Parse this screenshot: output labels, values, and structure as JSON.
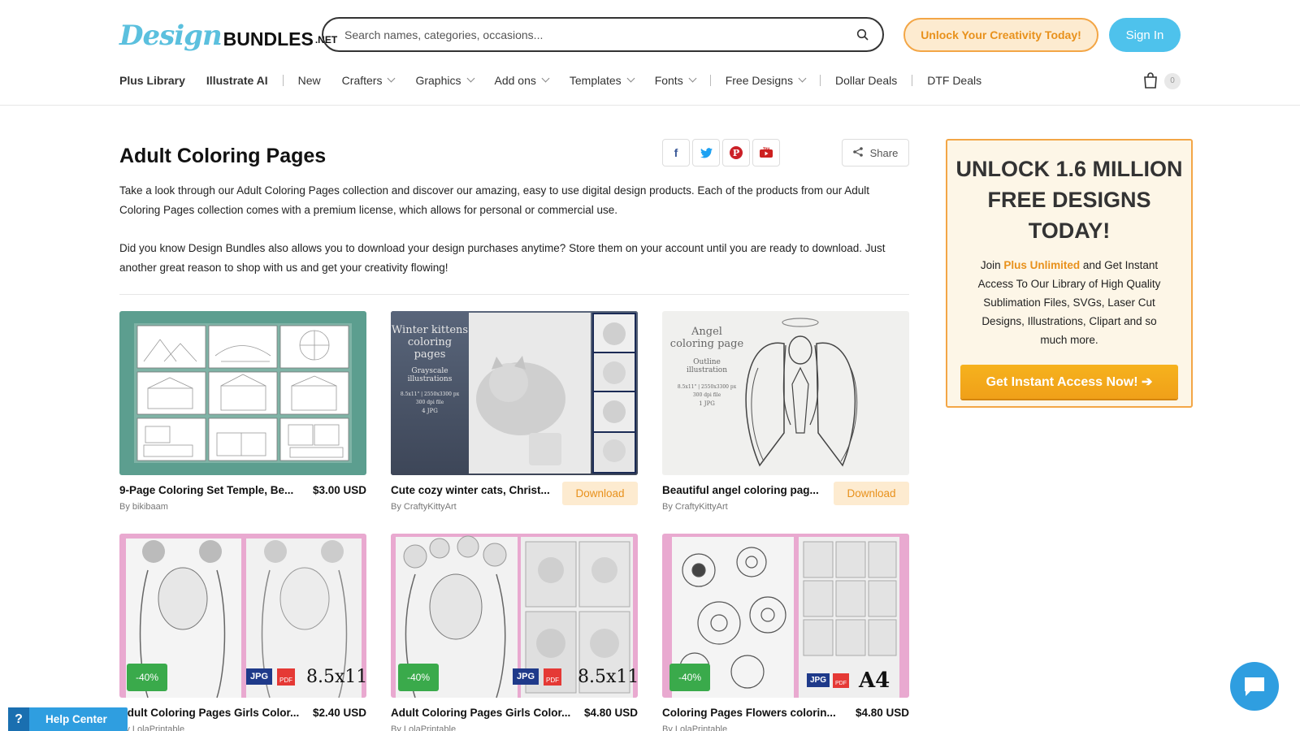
{
  "header": {
    "logo": {
      "script": "Design",
      "word": "BUNDLES",
      "tld": ".NET"
    },
    "search_placeholder": "Search names, categories, occasions...",
    "unlock_label": "Unlock Your Creativity Today!",
    "signin_label": "Sign In",
    "cart_count": "0",
    "nav": [
      {
        "label": "Plus Library"
      },
      {
        "label": "Illustrate AI"
      },
      {
        "label": "New"
      },
      {
        "label": "Crafters"
      },
      {
        "label": "Graphics"
      },
      {
        "label": "Add ons"
      },
      {
        "label": "Templates"
      },
      {
        "label": "Fonts"
      },
      {
        "label": "Free Designs"
      },
      {
        "label": "Dollar Deals"
      },
      {
        "label": "DTF Deals"
      }
    ]
  },
  "main": {
    "title": "Adult Coloring Pages",
    "share_label": "Share",
    "social": [
      "facebook-icon",
      "twitter-icon",
      "pinterest-icon",
      "youtube-icon"
    ],
    "description_1": "Take a look through our Adult Coloring Pages collection and discover our amazing, easy to use digital design products. Each of the products from our Adult Coloring Pages collection comes with a premium license, which allows for personal or commercial use.",
    "description_2": "Did you know Design Bundles also allows you to download your design purchases anytime? Store them on your account until you are ready to download. Just another great reason to shop with us and get your creativity flowing!"
  },
  "products": [
    {
      "title": "9-Page Coloring Set Temple, Be...",
      "author": "By bikibaam",
      "price": "$3.00 USD"
    },
    {
      "title": "Cute cozy winter cats, Christ...",
      "author": "By CraftyKittyArt",
      "download": "Download",
      "thumb_lines": [
        "Winter kittens",
        "coloring pages",
        "Grayscale",
        "illustrations",
        "8.5x11\" | 2550x3300 px",
        "300 dpi file",
        "4 JPG"
      ]
    },
    {
      "title": "Beautiful angel coloring pag...",
      "author": "By CraftyKittyArt",
      "download": "Download",
      "thumb_lines": [
        "Angel",
        "coloring page",
        "Outline",
        "illustration",
        "8.5x11\" | 2550x3300 px",
        "300 dpi file",
        "1 JPG"
      ]
    },
    {
      "title": "Adult Coloring Pages Girls Color...",
      "author": "By LolaPrintable",
      "price": "$2.40 USD",
      "badge": "-40%",
      "size": "8.5x11\"",
      "file": "JPG"
    },
    {
      "title": "Adult Coloring Pages Girls Color...",
      "author": "By LolaPrintable",
      "price": "$4.80 USD",
      "badge": "-40%",
      "size": "8.5x11\"",
      "file": "JPG"
    },
    {
      "title": "Coloring Pages Flowers colorin...",
      "author": "By LolaPrintable",
      "price": "$4.80 USD",
      "badge": "-40%",
      "size": "A4",
      "file": "JPG"
    }
  ],
  "promo": {
    "title": "UNLOCK 1.6 MILLION FREE DESIGNS TODAY!",
    "text_before": "Join ",
    "highlight": "Plus Unlimited",
    "text_after": " and Get Instant Access To Our Library of High Quality Sublimation Files, SVGs, Laser Cut Designs, Illustrations, Clipart and so much more.",
    "cta": "Get Instant Access Now! ➔"
  },
  "help_label": "Help Center",
  "colors": {
    "accent": "#4ec2ec",
    "orange": "#f3a646",
    "green_badge": "#3aaa4b",
    "teal_thumb": "#5c9e8f"
  }
}
